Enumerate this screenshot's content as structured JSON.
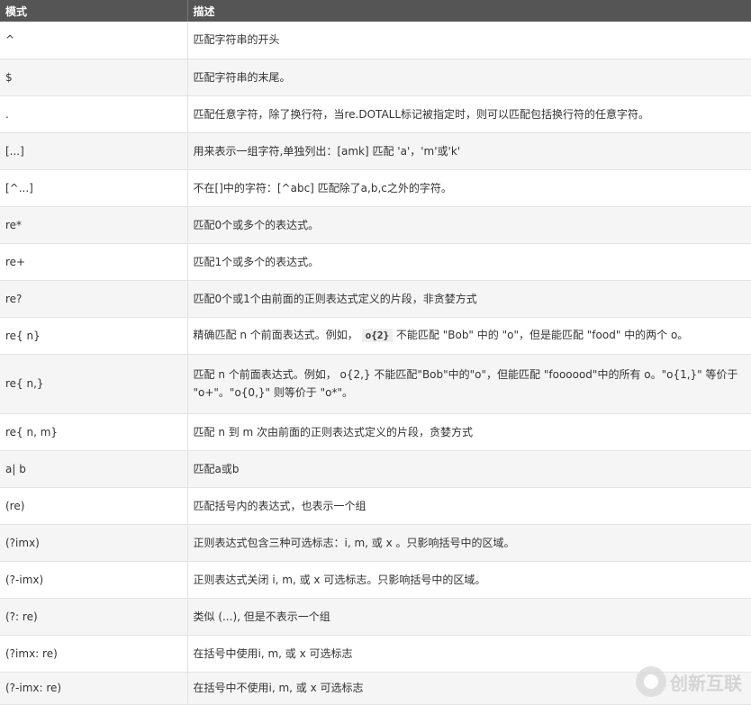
{
  "header": {
    "col_pattern": "模式",
    "col_desc": "描述"
  },
  "rows": [
    {
      "pattern": "^",
      "desc": [
        "匹配字符串的开头"
      ],
      "h": 41
    },
    {
      "pattern": "$",
      "desc": [
        "匹配字符串的末尾。"
      ],
      "h": 41
    },
    {
      "pattern": ".",
      "desc": [
        "匹配任意字符，除了换行符，当re.DOTALL标记被指定时，则可以匹配包括换行符的任意字符。"
      ],
      "h": 41
    },
    {
      "pattern": "[...]",
      "desc": [
        "用来表示一组字符,单独列出：[amk] 匹配 'a'，'m'或'k'"
      ],
      "h": 41
    },
    {
      "pattern": "[^...]",
      "desc": [
        "不在[]中的字符：[^abc] 匹配除了a,b,c之外的字符。"
      ],
      "h": 41
    },
    {
      "pattern": "re*",
      "desc": [
        "匹配0个或多个的表达式。"
      ],
      "h": 41
    },
    {
      "pattern": "re+",
      "desc": [
        "匹配1个或多个的表达式。"
      ],
      "h": 41
    },
    {
      "pattern": "re?",
      "desc": [
        "匹配0个或1个由前面的正则表达式定义的片段，非贪婪方式"
      ],
      "h": 41
    },
    {
      "pattern": "re{ n}",
      "desc": [
        "精确匹配 n 个前面表达式。例如，",
        "o{2}",
        "不能匹配 \"Bob\" 中的 \"o\"，但是能匹配 \"food\" 中的两个 o。"
      ],
      "h": 41
    },
    {
      "pattern": "re{ n,}",
      "desc": [
        "匹配 n 个前面表达式。例如， o{2,} 不能匹配\"Bob\"中的\"o\"，但能匹配 \"foooood\"中的所有 o。\"o{1,}\" 等价于 \"o+\"。\"o{0,}\" 则等价于 \"o*\"。"
      ],
      "h": 66
    },
    {
      "pattern": "re{ n, m}",
      "desc": [
        "匹配 n 到 m 次由前面的正则表达式定义的片段，贪婪方式"
      ],
      "h": 41
    },
    {
      "pattern": "a| b",
      "desc": [
        "匹配a或b"
      ],
      "h": 41
    },
    {
      "pattern": "(re)",
      "desc": [
        "匹配括号内的表达式，也表示一个组"
      ],
      "h": 41
    },
    {
      "pattern": "(?imx)",
      "desc": [
        "正则表达式包含三种可选标志：i, m, 或 x 。只影响括号中的区域。"
      ],
      "h": 41
    },
    {
      "pattern": "(?-imx)",
      "desc": [
        "正则表达式关闭 i, m, 或 x 可选标志。只影响括号中的区域。"
      ],
      "h": 41
    },
    {
      "pattern": "(?: re)",
      "desc": [
        "类似 (...), 但是不表示一个组"
      ],
      "h": 41
    },
    {
      "pattern": "(?imx: re)",
      "desc": [
        "在括号中使用i, m, 或 x 可选标志"
      ],
      "h": 41
    },
    {
      "pattern": "(?-imx: re)",
      "desc": [
        "在括号中不使用i, m, 或 x 可选标志"
      ],
      "h": 36
    }
  ],
  "watermark": {
    "text": "创新互联",
    "icon": "brand-logo-icon"
  }
}
